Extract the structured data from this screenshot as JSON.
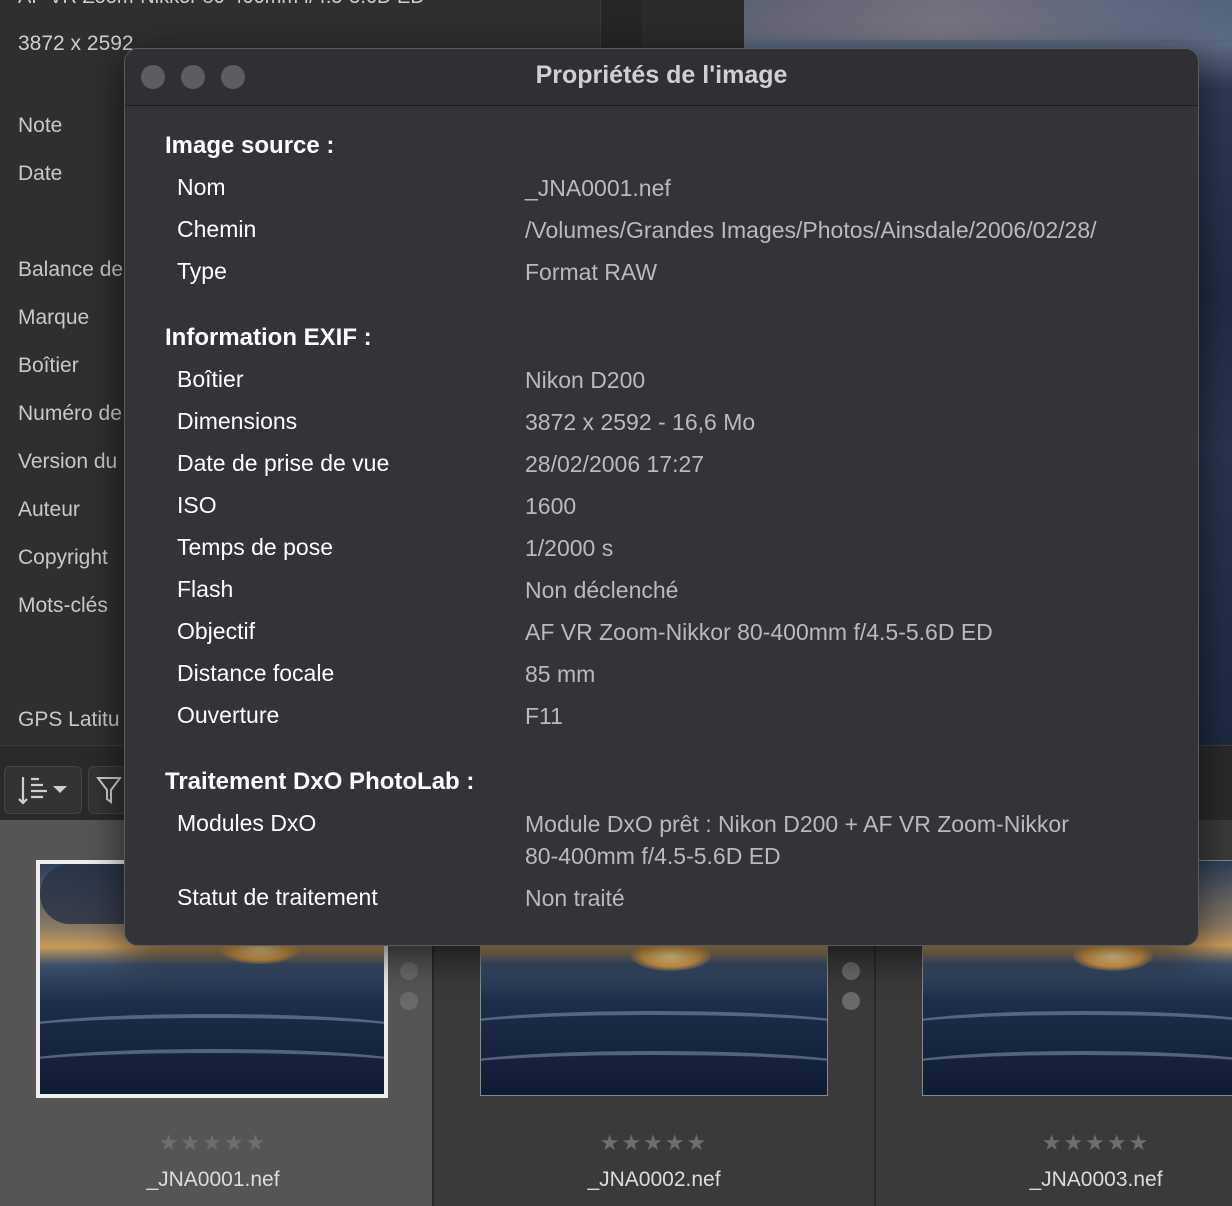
{
  "left_panel": {
    "top_text": "AF VR Zoom-Nikkor 80-400mm f/4.5-5.6D ED",
    "dimensions": "3872 x 2592",
    "labels": [
      "Note",
      "Date",
      "Balance de",
      "Marque",
      "Boîtier",
      "Numéro de",
      "Version du",
      "Auteur",
      "Copyright",
      "Mots-clés",
      "GPS Latitu"
    ]
  },
  "toolbar": {
    "sort_icon": "sort-icon",
    "dropdown_icon": "chevron-down-icon",
    "filter_icon": "filter-icon"
  },
  "dialog": {
    "title": "Propriétés de l'image",
    "sections": [
      {
        "title": "Image source :",
        "rows": [
          {
            "label": "Nom",
            "value": "_JNA0001.nef"
          },
          {
            "label": "Chemin",
            "value": "/Volumes/Grandes Images/Photos/Ainsdale/2006/02/28/"
          },
          {
            "label": "Type",
            "value": "Format RAW"
          }
        ]
      },
      {
        "title": "Information EXIF :",
        "rows": [
          {
            "label": "Boîtier",
            "value": "Nikon D200"
          },
          {
            "label": "Dimensions",
            "value": "3872 x 2592 - 16,6 Mo"
          },
          {
            "label": "Date de prise de vue",
            "value": "28/02/2006 17:27"
          },
          {
            "label": "ISO",
            "value": "1600"
          },
          {
            "label": "Temps de pose",
            "value": "1/2000 s"
          },
          {
            "label": "Flash",
            "value": "Non déclenché"
          },
          {
            "label": "Objectif",
            "value": "AF VR Zoom-Nikkor 80-400mm f/4.5-5.6D ED"
          },
          {
            "label": "Distance focale",
            "value": "85 mm"
          },
          {
            "label": "Ouverture",
            "value": "F11"
          }
        ]
      },
      {
        "title": "Traitement DxO PhotoLab :",
        "rows": [
          {
            "label": "Modules DxO",
            "value": "Module DxO prêt : Nikon D200 + AF VR Zoom-Nikkor",
            "value2": "80-400mm f/4.5-5.6D ED"
          },
          {
            "label": "Statut de traitement",
            "value": "Non traité"
          }
        ]
      }
    ]
  },
  "filmstrip": [
    {
      "filename": "_JNA0001.nef",
      "stars": "★★★★★",
      "selected": true
    },
    {
      "filename": "_JNA0002.nef",
      "stars": "★★★★★",
      "selected": false
    },
    {
      "filename": "_JNA0003.nef",
      "stars": "★★★★★",
      "selected": false
    }
  ]
}
